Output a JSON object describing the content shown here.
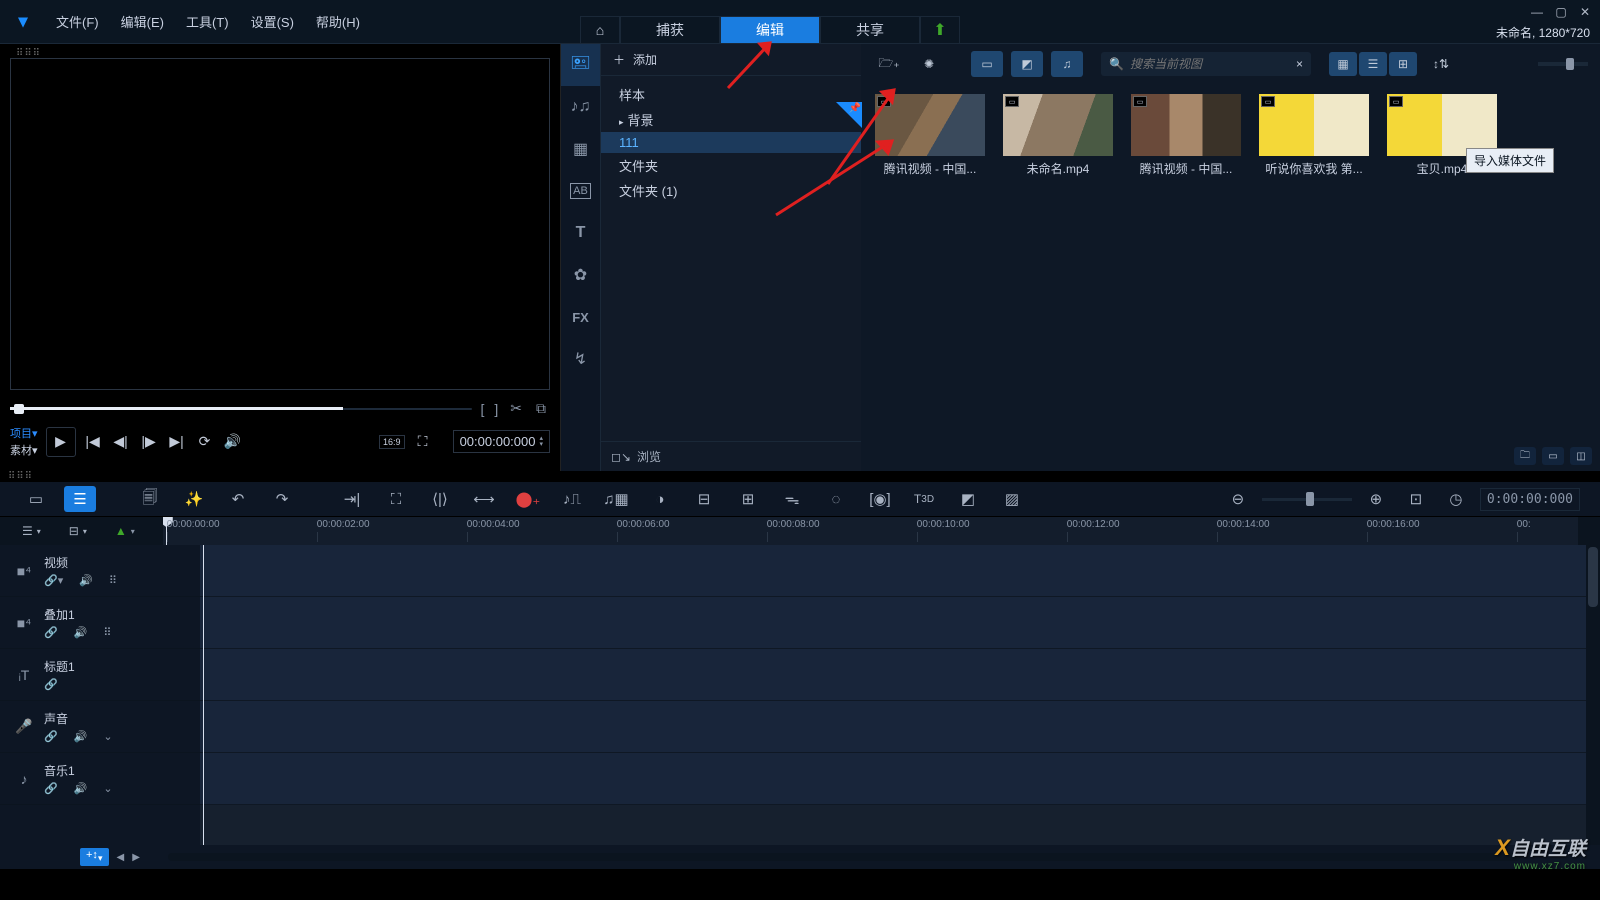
{
  "menu": {
    "file": "文件(F)",
    "edit": "编辑(E)",
    "tools": "工具(T)",
    "settings": "设置(S)",
    "help": "帮助(H)"
  },
  "tabs": {
    "capture": "捕获",
    "edit": "编辑",
    "share": "共享"
  },
  "project_info": "未命名, 1280*720",
  "transport": {
    "project_label": "项目▾",
    "clip_label": "素材▾",
    "timecode": "00:00:00:000",
    "aspect": "16:9"
  },
  "folder": {
    "add": "添加",
    "sample": "样本",
    "background": "背景",
    "f111": "111",
    "folder": "文件夹",
    "folder1": "文件夹 (1)",
    "browse": "浏览"
  },
  "media_toolbar": {
    "tooltip": "导入媒体文件",
    "search_placeholder": "搜索当前视图"
  },
  "thumbs": [
    {
      "name": "腾讯视频 - 中国..."
    },
    {
      "name": "未命名.mp4"
    },
    {
      "name": "腾讯视频 - 中国..."
    },
    {
      "name": "听说你喜欢我 第..."
    },
    {
      "name": "宝贝.mp4"
    }
  ],
  "ruler": [
    "00:00:00:00",
    "00:00:02:00",
    "00:00:04:00",
    "00:00:06:00",
    "00:00:08:00",
    "00:00:10:00",
    "00:00:12:00",
    "00:00:14:00",
    "00:00:16:00",
    "00:"
  ],
  "tracks": {
    "video": "视频",
    "overlay": "叠加1",
    "title": "标题1",
    "voice": "声音",
    "music": "音乐1"
  },
  "tl_timecode": "0:00:00:000",
  "watermark": {
    "brand": "自由互联",
    "url": "www.xz7.com"
  }
}
